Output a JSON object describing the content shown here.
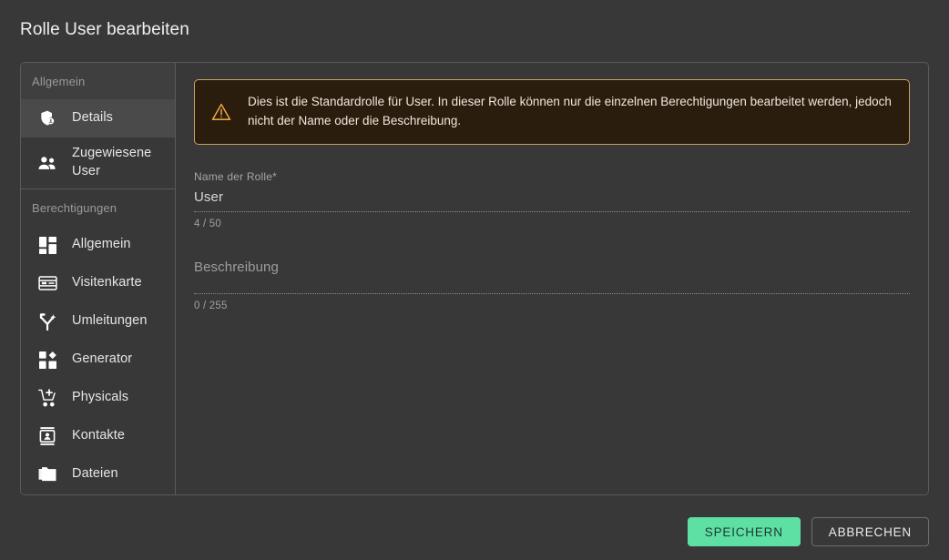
{
  "dialog": {
    "title": "Rolle User bearbeiten"
  },
  "sidebar": {
    "groups": [
      {
        "label": "Allgemein",
        "items": [
          {
            "label": "Details",
            "icon": "shield-badge-icon",
            "active": true
          },
          {
            "label": "Zugewiesene User",
            "icon": "users-icon",
            "active": false
          }
        ]
      },
      {
        "label": "Berechtigungen",
        "items": [
          {
            "label": "Allgemein",
            "icon": "dashboard-grid-icon",
            "active": false
          },
          {
            "label": "Visitenkarte",
            "icon": "business-card-icon",
            "active": false
          },
          {
            "label": "Umleitungen",
            "icon": "redirect-branch-icon",
            "active": false
          },
          {
            "label": "Generator",
            "icon": "generator-shapes-icon",
            "active": false
          },
          {
            "label": "Physicals",
            "icon": "cart-plus-icon",
            "active": false
          },
          {
            "label": "Kontakte",
            "icon": "contact-card-icon",
            "active": false
          },
          {
            "label": "Dateien",
            "icon": "folder-stack-icon",
            "active": false
          }
        ]
      }
    ]
  },
  "alert": {
    "icon": "warning-triangle-icon",
    "text": "Dies ist die Standardrolle für User. In dieser Rolle können nur die einzelnen Berechtigungen bearbeitet werden, jedoch nicht der Name oder die Beschreibung.",
    "border_color": "#c9a15e",
    "background_color": "#2a1d0d"
  },
  "form": {
    "name_field": {
      "label": "Name der Rolle*",
      "value": "User",
      "counter": "4 / 50"
    },
    "description_field": {
      "placeholder": "Beschreibung",
      "value": "",
      "counter": "0 / 255"
    }
  },
  "footer": {
    "save_label": "SPEICHERN",
    "cancel_label": "ABBRECHEN",
    "save_color": "#5ee0a4"
  }
}
